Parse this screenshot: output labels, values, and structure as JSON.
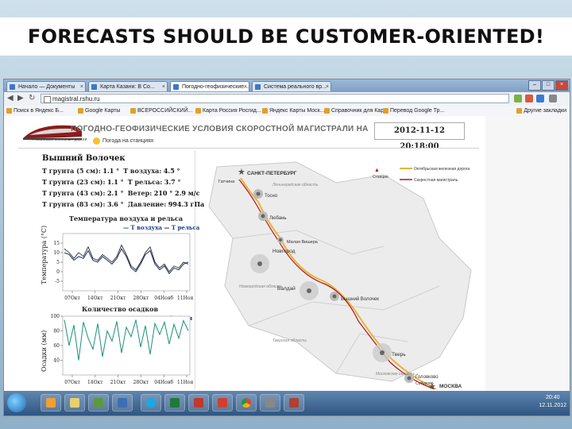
{
  "slide": {
    "title": "FORECASTS SHOULD BE CUSTOMER-ORIENTED!"
  },
  "browser": {
    "tabs": [
      {
        "label": "Начало — Документы",
        "active": false
      },
      {
        "label": "Карта Казани: В Со...",
        "active": false
      },
      {
        "label": "Погодно-геофизические...",
        "active": true
      },
      {
        "label": "Система реального вр...",
        "active": false
      }
    ],
    "url": "magistral.rshu.ru",
    "bookmarks": [
      "Поиск в Яндекс Б...",
      "Google Карты",
      "ВСЕРОССИЙСКИЙ...",
      "Карта Россия Росгид...",
      "Яндекс Карты Моск...",
      "Справочник для Кар...",
      "Перевод Google Тр..."
    ],
    "other_bookmarks": "Другие закладки"
  },
  "page": {
    "heading": "ПОГОДНО-ГЕОФИЗИЧЕСКИЕ УСЛОВИЯ СКОРОСТНОЙ МАГИСТРАЛИ НА",
    "datetime": "2012-11-12 20:18:00",
    "logo_caption": "Российские железные дороги",
    "weather_link": "Погода на станциях",
    "station": "Вышний Волочек",
    "measurements": [
      {
        "label": "T грунта (5 см):",
        "value": "1.1 °",
        "label2": "T воздуха:",
        "value2": "4.5 °"
      },
      {
        "label": "T грунта (23 см):",
        "value": "1.1 °",
        "label2": "T рельса:",
        "value2": "3.7 °"
      },
      {
        "label": "T грунта (43 см):",
        "value": "2.1 °",
        "label2": "Ветер:",
        "value2": "210 ° 2.9 м/с"
      },
      {
        "label": "T грунта (83 см):",
        "value": "3.6 °",
        "label2": "Давление:",
        "value2": "994.3 гПа"
      }
    ]
  },
  "chart_data": [
    {
      "type": "line",
      "title": "Температура воздуха и рельса",
      "ylabel": "Температура (°С)",
      "xlabel": "",
      "x_ticks": [
        "07Окт",
        "14Окт",
        "21Окт",
        "28Окт",
        "04Нояб",
        "11Нояб"
      ],
      "ylim": [
        -10,
        20
      ],
      "y_ticks": [
        -5,
        0,
        5,
        10,
        15
      ],
      "legend": [
        "T воздуха",
        "T рельса"
      ],
      "series": [
        {
          "name": "T воздуха",
          "values": [
            10,
            9,
            6,
            8,
            7,
            11,
            6,
            5,
            8,
            6,
            4,
            7,
            12,
            8,
            2,
            0,
            4,
            9,
            11,
            4,
            1,
            3,
            -1,
            2,
            1,
            4,
            5
          ]
        },
        {
          "name": "T рельса",
          "values": [
            12,
            10,
            7,
            10,
            8,
            13,
            7,
            6,
            9,
            7,
            5,
            8,
            14,
            9,
            3,
            1,
            5,
            10,
            13,
            5,
            2,
            4,
            0,
            3,
            2,
            5,
            4
          ]
        }
      ]
    },
    {
      "type": "line",
      "title": "Количество осадков",
      "ylabel": "Осадки (мм)",
      "xlabel": "",
      "x_ticks": [
        "07Окт",
        "14Окт",
        "21Окт",
        "28Окт",
        "04Нояб",
        "11Нояб"
      ],
      "ylim": [
        20,
        100
      ],
      "y_ticks": [
        40,
        60,
        80,
        100
      ],
      "legend": [
        "Осадки"
      ],
      "series": [
        {
          "name": "Осадки",
          "values": [
            95,
            60,
            88,
            40,
            92,
            70,
            55,
            90,
            45,
            80,
            66,
            93,
            50,
            85,
            72,
            95,
            58,
            87,
            48,
            90,
            75,
            92,
            62,
            89,
            70,
            94,
            80
          ]
        }
      ]
    }
  ],
  "map": {
    "legend": {
      "station": "Станция",
      "railway": "Октябрьская железная дорога",
      "highway": "Скоростная магистраль"
    },
    "cities": [
      {
        "name": "САНКТ-ПЕТЕРБУРГ",
        "type": "capital"
      },
      {
        "name": "Гатчина",
        "type": "small"
      },
      {
        "name": "Ленинградская область",
        "type": "region"
      },
      {
        "name": "Тосно",
        "type": "station"
      },
      {
        "name": "Любань",
        "type": "station"
      },
      {
        "name": "Малая Вишера",
        "type": "station"
      },
      {
        "name": "Новгород",
        "type": "station"
      },
      {
        "name": "Новгородская область",
        "type": "region"
      },
      {
        "name": "Валдай",
        "type": "station"
      },
      {
        "name": "Вышний Волочек",
        "type": "station"
      },
      {
        "name": "Тверская область",
        "type": "region"
      },
      {
        "name": "Тверь",
        "type": "station"
      },
      {
        "name": "Московская область",
        "type": "region"
      },
      {
        "name": "Головково",
        "type": "station"
      },
      {
        "name": "Сабурово",
        "type": "small"
      },
      {
        "name": "МОСКВА",
        "type": "capital"
      }
    ]
  },
  "taskbar": {
    "time": "20:40",
    "date": "12.11.2012"
  },
  "colors": {
    "railway": "#e8b43a",
    "highway": "#b7131a",
    "series_air": "#1b2f6e",
    "series_precip": "#1c8f7a"
  }
}
